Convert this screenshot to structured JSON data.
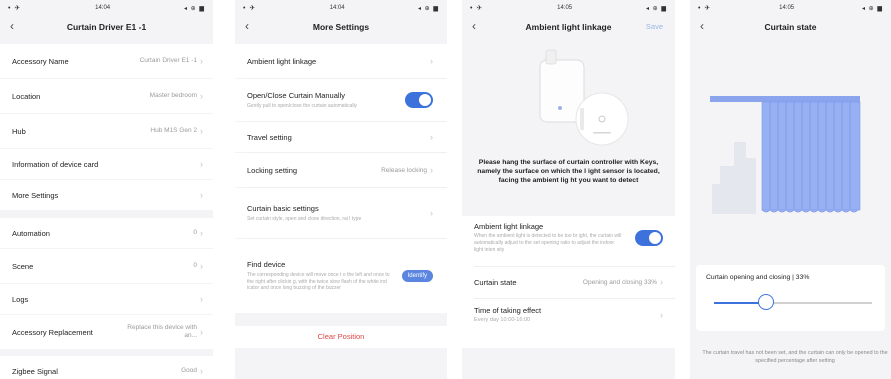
{
  "status": {
    "time_1": "14:04",
    "time_2": "14:04",
    "time_3": "14:05",
    "time_4": "14:05",
    "left_glyphs": "• ✈",
    "right_glyphs": "◂ ⊕ ▆"
  },
  "screen1": {
    "title": "Curtain Driver E1 -1",
    "rows": [
      {
        "label": "Accessory Name",
        "value": "Curtain Driver E1 -1"
      },
      {
        "label": "Location",
        "value": "Master bedroom"
      },
      {
        "label": "Hub",
        "value": "Hub M1S Gen 2"
      },
      {
        "label": "Information of device card",
        "value": ""
      },
      {
        "label": "More Settings",
        "value": ""
      },
      {
        "label": "Automation",
        "value": "0"
      },
      {
        "label": "Scene",
        "value": "0"
      },
      {
        "label": "Logs",
        "value": ""
      },
      {
        "label": "Accessory Replacement",
        "value": "Replace this device with an..."
      },
      {
        "label": "Zigbee Signal",
        "value": "Good"
      }
    ]
  },
  "screen2": {
    "title": "More Settings",
    "ambient_light_linkage": "Ambient light linkage",
    "manual": {
      "label": "Open/Close Curtain Manually",
      "sub": "Gently pull to open/close the curtain automatically",
      "enabled": true
    },
    "travel_setting": "Travel setting",
    "locking": {
      "label": "Locking setting",
      "value": "Release locking"
    },
    "basic": {
      "label": "Curtain basic settings",
      "sub": "Set curtain style, open and close direction, rai l type"
    },
    "find": {
      "label": "Find device",
      "sub": "The corresponding device will move once t o the left and once to the right after clickin g, with the twice slow flash of the white ind icator and once long buzzing of the buzzer",
      "button": "Identify"
    },
    "clear_position": "Clear Position"
  },
  "screen3": {
    "title": "Ambient light linkage",
    "save": "Save",
    "instruction": "Please hang the surface of curtain controller with Keys, namely the surface on which the l ight sensor is located, facing the ambient lig ht you want to detect",
    "linkage": {
      "label": "Ambient light linkage",
      "sub": "When the ambient light is detected to be too br ight, the curtain will automatically adjust to the set opening ratio to adjust the indoor light inten sity",
      "enabled": true
    },
    "curtain_state": {
      "label": "Curtain state",
      "value": "Opening and closing 33%"
    },
    "time": {
      "label": "Time of taking effect",
      "sub": "Every day 10:00-16:00"
    }
  },
  "screen4": {
    "title": "Curtain state",
    "slider_title": "Curtain opening and closing | 33%",
    "slider_value": 0.33,
    "note": "The curtain travel has not been set, and the curtain can only be opened to the specified percentage after setting"
  },
  "colors": {
    "accent": "#3d72dc",
    "danger": "#e04646",
    "curtain": "#8fa8f0"
  }
}
